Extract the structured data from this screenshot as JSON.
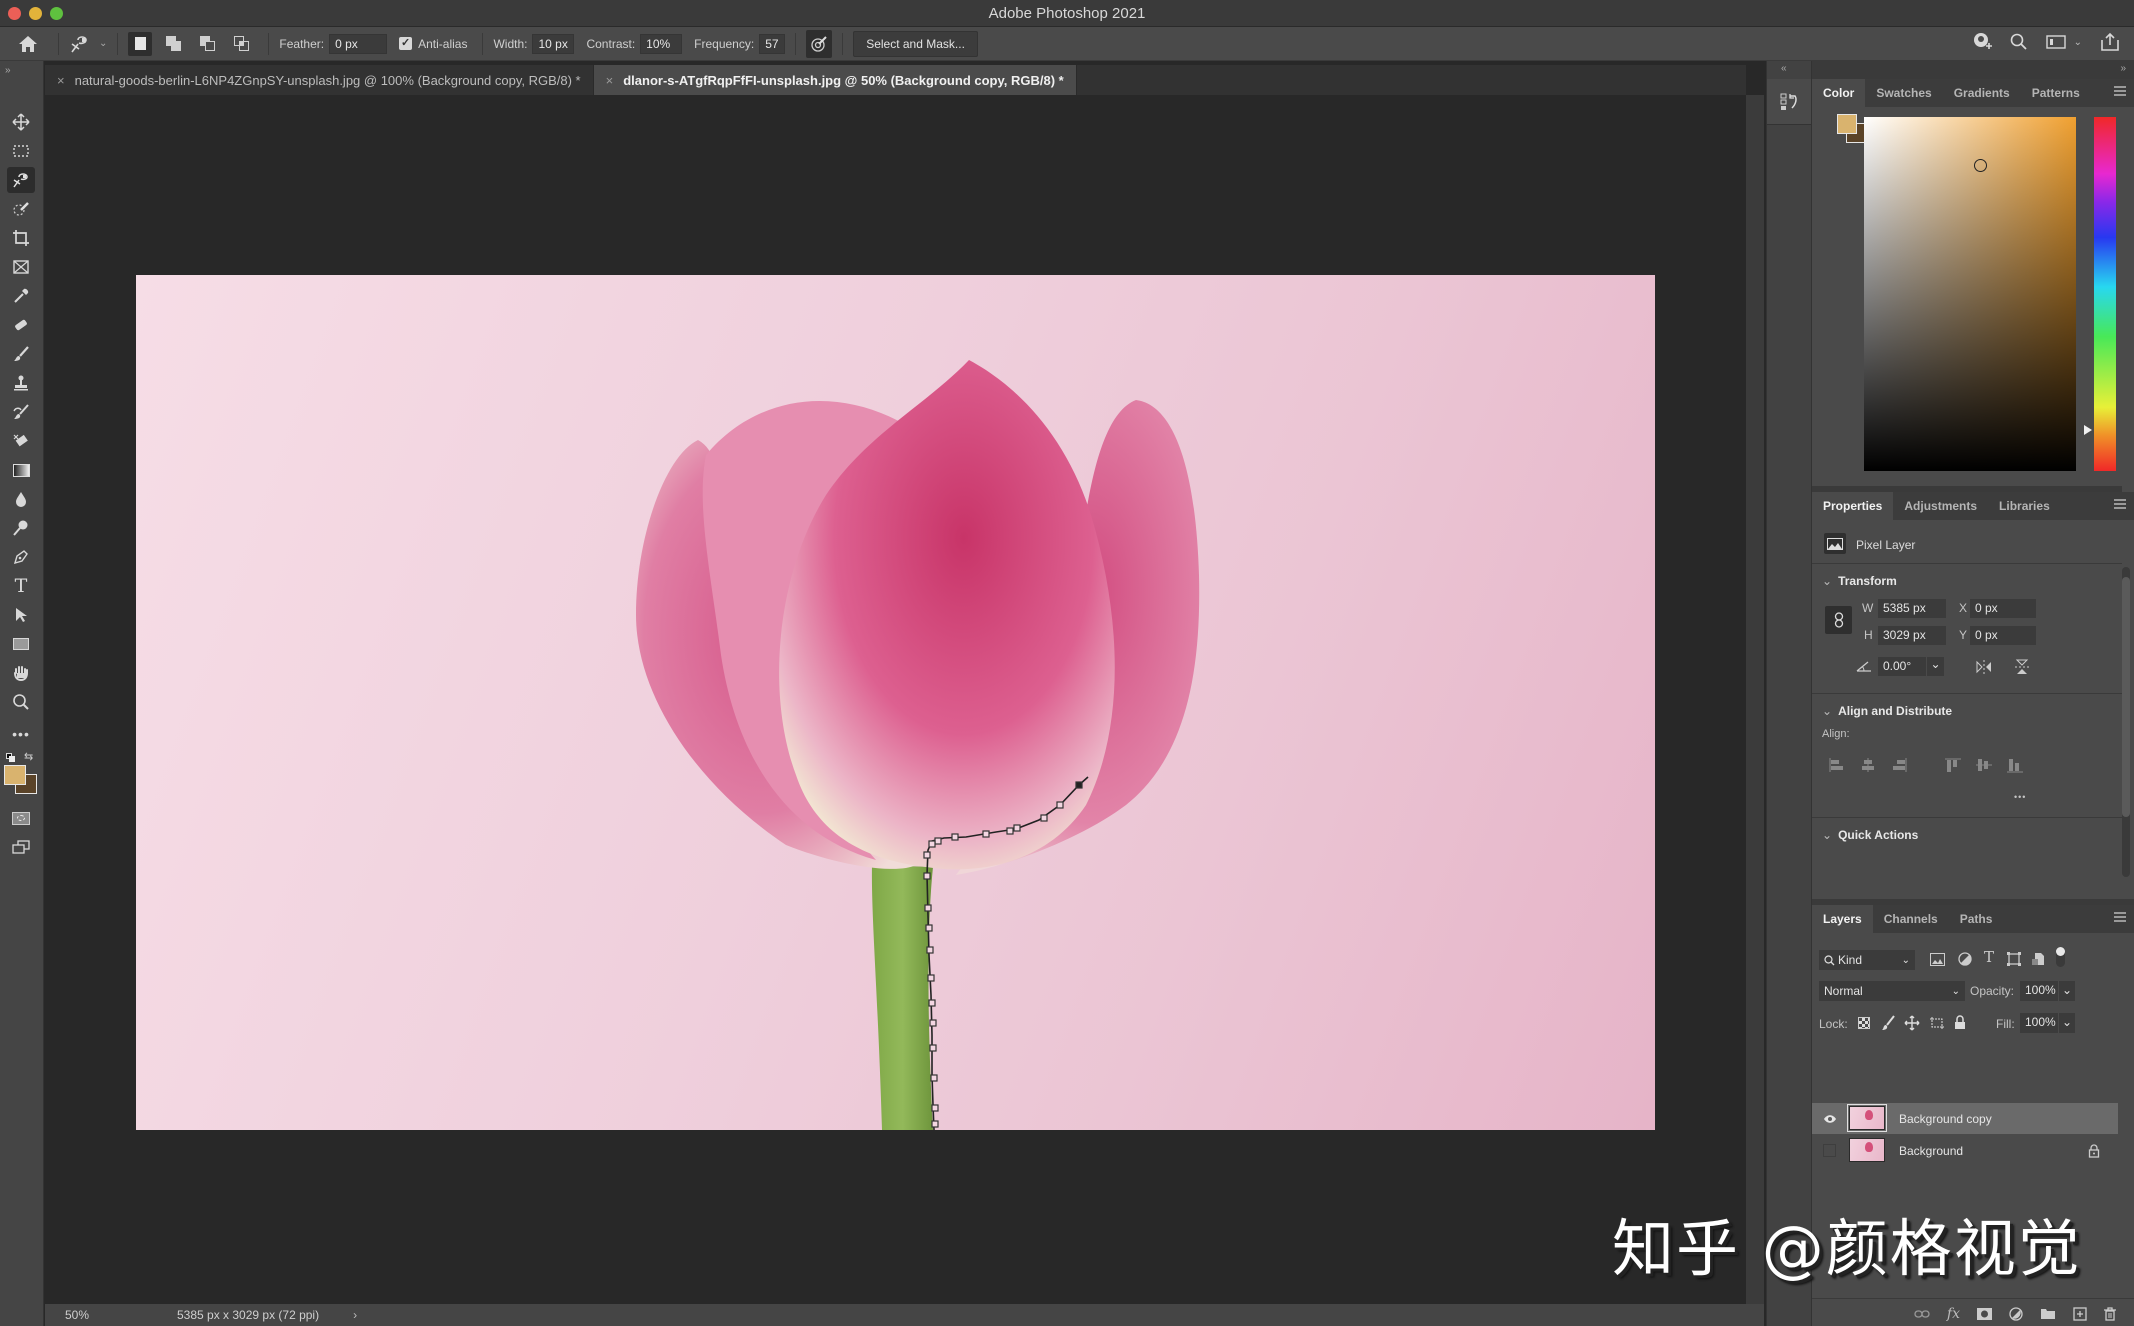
{
  "window": {
    "title": "Adobe Photoshop 2021",
    "traffic_lights": {
      "close": "#ec5f57",
      "minimize": "#e2b33a",
      "maximize": "#5fc13f"
    }
  },
  "options_bar": {
    "home_icon": "home-icon",
    "tool_icon": "magnetic-lasso-icon",
    "selection_modes": [
      "new-selection",
      "add-to-selection",
      "subtract-from-selection",
      "intersect-selection"
    ],
    "feather_label": "Feather:",
    "feather_value": "0 px",
    "anti_alias_label": "Anti-alias",
    "anti_alias_checked": true,
    "width_label": "Width:",
    "width_value": "10 px",
    "contrast_label": "Contrast:",
    "contrast_value": "10%",
    "frequency_label": "Frequency:",
    "frequency_value": "57",
    "pen_pressure_icon": "pen-pressure-icon",
    "select_mask_label": "Select and Mask...",
    "right_icons": [
      "share-user-icon",
      "search-icon",
      "workspace-icon",
      "chevron-down-icon",
      "share-icon"
    ]
  },
  "tabs": [
    {
      "label": "natural-goods-berlin-L6NP4ZGnpSY-unsplash.jpg @ 100% (Background copy, RGB/8) *",
      "active": false
    },
    {
      "label": "dlanor-s-ATgfRqpFfFI-unsplash.jpg @ 50% (Background copy, RGB/8) *",
      "active": true
    }
  ],
  "toolbar": {
    "tools": [
      "move",
      "rectangular-marquee",
      "magnetic-lasso",
      "quick-selection",
      "crop",
      "frame",
      "eyedropper",
      "spot-healing",
      "brush",
      "clone-stamp",
      "history-brush",
      "eraser",
      "gradient",
      "blur",
      "dodge",
      "pen",
      "type",
      "path-selection",
      "rectangle",
      "hand",
      "zoom",
      "more"
    ],
    "active_tool": "magnetic-lasso",
    "foreground_color": "#d9b36e",
    "background_color": "#5a4328"
  },
  "status_bar": {
    "zoom": "50%",
    "doc_info": "5385 px x 3029 px (72 ppi)",
    "arrow": "›"
  },
  "color_panel": {
    "tabs": [
      "Color",
      "Swatches",
      "Gradients",
      "Patterns"
    ],
    "active_tab": "Color",
    "foreground": "#d9b36e",
    "background": "#5a4328",
    "hue_base": "#f0a030"
  },
  "properties_panel": {
    "tabs": [
      "Properties",
      "Adjustments",
      "Libraries"
    ],
    "active_tab": "Properties",
    "layer_type": "Pixel Layer",
    "transform": {
      "title": "Transform",
      "w_label": "W",
      "w_value": "5385 px",
      "h_label": "H",
      "h_value": "3029 px",
      "x_label": "X",
      "x_value": "0 px",
      "y_label": "Y",
      "y_value": "0 px",
      "angle_value": "0.00°"
    },
    "align": {
      "title": "Align and Distribute",
      "align_label": "Align:",
      "more": "•••"
    },
    "quick_actions": {
      "title": "Quick Actions"
    }
  },
  "layers_panel": {
    "tabs": [
      "Layers",
      "Channels",
      "Paths"
    ],
    "active_tab": "Layers",
    "filter_kind": "Kind",
    "blend_mode": "Normal",
    "opacity_label": "Opacity:",
    "opacity_value": "100%",
    "lock_label": "Lock:",
    "fill_label": "Fill:",
    "fill_value": "100%",
    "layers": [
      {
        "name": "Background copy",
        "visible": true,
        "selected": true,
        "locked": false
      },
      {
        "name": "Background",
        "visible": false,
        "selected": false,
        "locked": true
      }
    ],
    "bottom_icons": [
      "link-icon",
      "fx-icon",
      "mask-icon",
      "adjustment-icon",
      "folder-icon",
      "new-layer-icon",
      "trash-icon"
    ]
  },
  "watermark": "知乎 @颜格视觉"
}
